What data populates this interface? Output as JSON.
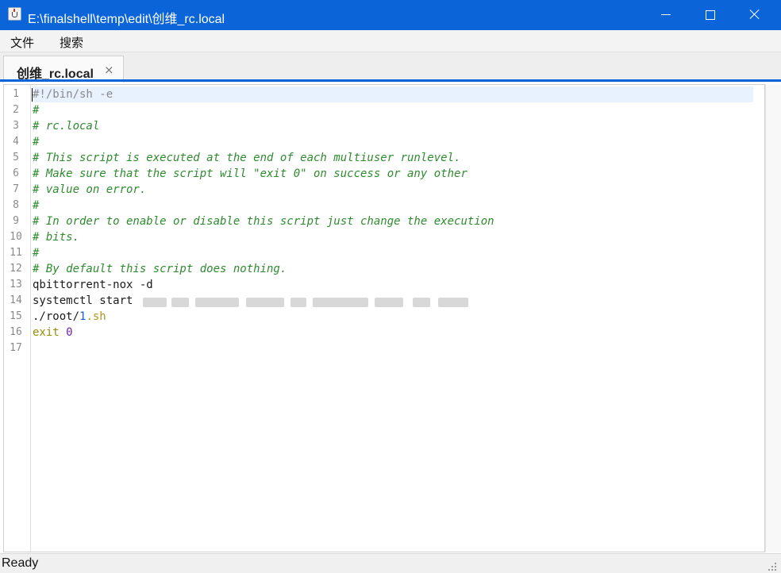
{
  "window": {
    "title": "E:\\finalshell\\temp\\edit\\创维_rc.local",
    "app_icon": "java-cup-icon",
    "controls": [
      "minimize-icon",
      "maximize-icon",
      "close-icon"
    ]
  },
  "menu": {
    "items": [
      {
        "label": "文件"
      },
      {
        "label": "搜索"
      }
    ]
  },
  "tabs": [
    {
      "label": "创维_rc.local",
      "close_glyph": "×",
      "active": true
    }
  ],
  "editor": {
    "line_numbers": [
      "1",
      "2",
      "3",
      "4",
      "5",
      "6",
      "7",
      "8",
      "9",
      "10",
      "11",
      "12",
      "13",
      "14",
      "15",
      "16",
      "17"
    ],
    "lines": [
      {
        "text": "#!/bin/sh -e",
        "kind": "shebang"
      },
      {
        "text": "#",
        "kind": "comment"
      },
      {
        "text": "# rc.local",
        "kind": "comment"
      },
      {
        "text": "#",
        "kind": "comment"
      },
      {
        "text": "# This script is executed at the end of each multiuser runlevel.",
        "kind": "comment"
      },
      {
        "text": "# Make sure that the script will \"exit 0\" on success or any other",
        "kind": "comment"
      },
      {
        "text": "# value on error.",
        "kind": "comment"
      },
      {
        "text": "#",
        "kind": "comment"
      },
      {
        "text": "# In order to enable or disable this script just change the execution",
        "kind": "comment"
      },
      {
        "text": "# bits.",
        "kind": "comment"
      },
      {
        "text": "#",
        "kind": "comment"
      },
      {
        "text": "# By default this script does nothing.",
        "kind": "comment"
      },
      {
        "text": "qbittorrent-nox -d",
        "kind": "plain"
      },
      {
        "text": "systemctl start",
        "kind": "plain",
        "redacted_tail": true
      },
      {
        "text": "./root/1.sh",
        "kind": "path",
        "parts": [
          "./root/",
          "1",
          ".sh"
        ]
      },
      {
        "text": "exit 0",
        "kind": "exit",
        "parts": [
          "exit",
          " ",
          "0"
        ]
      },
      {
        "text": "",
        "kind": "plain"
      }
    ],
    "current_line": 1
  },
  "colors": {
    "titlebar": "#0b64d8",
    "comment": "#2e8b2e",
    "keyword": "#9b8a0a",
    "number": "#6b1fa8",
    "current_line_bg": "#e8f2fe"
  },
  "status": {
    "text": "Ready"
  }
}
